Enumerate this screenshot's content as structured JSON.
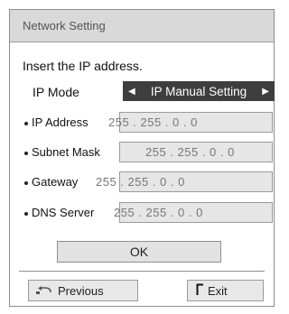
{
  "dialog": {
    "title": "Network Setting",
    "prompt": "Insert the IP address."
  },
  "ip_mode": {
    "label": "IP Mode",
    "value": "IP Manual Setting"
  },
  "fields": {
    "ip_address": {
      "label": "IP Address",
      "value": "255 . 255 . 0 . 0"
    },
    "subnet_mask": {
      "label": "Subnet Mask",
      "value": "255 . 255 . 0 . 0"
    },
    "gateway": {
      "label": "Gateway",
      "value": "255 . 255 . 0 . 0"
    },
    "dns_server": {
      "label": "DNS Server",
      "value": "255 . 255 . 0 . 0"
    }
  },
  "buttons": {
    "ok": "OK",
    "previous": "Previous",
    "exit": "Exit"
  },
  "icons": {
    "previous": "return-arrow-icon",
    "exit": "exit-bracket-icon"
  },
  "colors": {
    "title_bar": "#d9d9d9",
    "selector_bg": "#3e3e3e",
    "field_bg": "#e6e6e6"
  }
}
